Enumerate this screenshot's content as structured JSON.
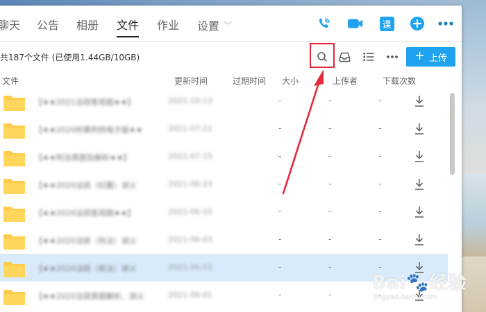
{
  "tabs": [
    {
      "label": "聊天"
    },
    {
      "label": "公告"
    },
    {
      "label": "相册"
    },
    {
      "label": "文件",
      "active": true
    },
    {
      "label": "作业"
    },
    {
      "label": "设置"
    }
  ],
  "header_icons": {
    "call": "phone-icon",
    "video": "video-icon",
    "course_label": "课",
    "add": "plus-circle-icon",
    "more": "more-icon"
  },
  "toolbar": {
    "summary": "共187个文件 (已使用1.44GB/10GB)",
    "upload_label": "上传",
    "search": "search-icon",
    "inbox": "inbox-icon",
    "list": "list-icon",
    "more": "more-icon"
  },
  "columns": {
    "file": "文件",
    "updated": "更新时间",
    "expires": "过期时间",
    "size": "大小",
    "uploader": "上传者",
    "downloads": "下载次数"
  },
  "rows": [
    {
      "name": "【★★2021法硕客观题★★】",
      "date": "2021-10-13",
      "expires": "-",
      "size": "-",
      "uploader": "-"
    },
    {
      "name": "【★★2020刑事判例电子版★★",
      "date": "2021-07-21",
      "expires": "-",
      "size": "-",
      "uploader": "-"
    },
    {
      "name": "【★★刑法真题及解析★★】",
      "date": "2021-07-15",
      "expires": "-",
      "size": "-",
      "uploader": "-"
    },
    {
      "name": "【★★2020法硕（纪要）讲义",
      "date": "2021-06-23",
      "expires": "-",
      "size": "-",
      "uploader": "-"
    },
    {
      "name": "【★★2020法硕客观题★★】",
      "date": "2021-06-10",
      "expires": "-",
      "size": "-",
      "uploader": "-"
    },
    {
      "name": "【★★2020法硕（刑法）讲义",
      "date": "2021-06-03",
      "expires": "-",
      "size": "-",
      "uploader": "-"
    },
    {
      "name": "【★★2020法硕（宪法）讲义",
      "date": "2021-06-03",
      "expires": "-",
      "size": "-",
      "uploader": "-",
      "selected": true
    },
    {
      "name": "【★★2020法硕真题解析、讲义",
      "date": "2021-06-01",
      "expires": "-",
      "size": "-",
      "uploader": "-"
    }
  ],
  "colors": {
    "accent": "#1fa2ef",
    "selected_row": "#d9ebfb",
    "folder": "#ffcc4d",
    "annotation": "#e5283a"
  },
  "watermark": {
    "brand": "Bai",
    "brand_cn": "经验",
    "url": "jingyan.baidu.com"
  }
}
